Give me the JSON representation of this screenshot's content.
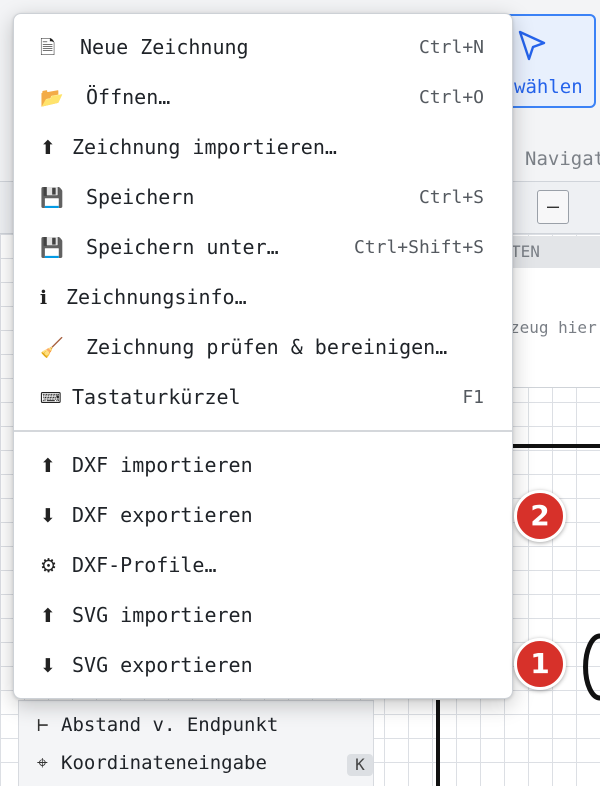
{
  "background": {
    "select_tool_label": "wählen",
    "navigation_tab": "Navigat",
    "collapse_label": "–",
    "props_header": "TEN",
    "props_hint": "zeug hier",
    "snap_items": [
      {
        "glyph": "⊢",
        "label": "Abstand v. Endpunkt"
      },
      {
        "glyph": "⌖",
        "label": "Koordinateneingabe",
        "key": "K"
      }
    ]
  },
  "menu": {
    "items": [
      {
        "icon": "🗎",
        "icon_name": "document-icon",
        "label": "Neue Zeichnung",
        "shortcut": "Ctrl+N"
      },
      {
        "icon": "📂",
        "icon_name": "open-folder-icon",
        "label": "Öffnen…",
        "shortcut": "Ctrl+O"
      },
      {
        "icon": "⬆",
        "icon_name": "upload-icon",
        "label": "Zeichnung importieren…",
        "shortcut": ""
      },
      {
        "icon": "💾",
        "icon_name": "floppy-disk-icon",
        "label": "Speichern",
        "shortcut": "Ctrl+S"
      },
      {
        "icon": "💾",
        "icon_name": "floppy-disk-icon",
        "label": "Speichern unter…",
        "shortcut": "Ctrl+Shift+S"
      },
      {
        "icon": "ℹ",
        "icon_name": "info-icon",
        "label": "Zeichnungsinfo…",
        "shortcut": ""
      },
      {
        "icon": "🧹",
        "icon_name": "broom-icon",
        "label": "Zeichnung prüfen & bereinigen…",
        "shortcut": ""
      },
      {
        "icon": "⌨",
        "icon_name": "keyboard-icon",
        "label": "Tastaturkürzel",
        "shortcut": "F1"
      },
      {
        "icon": "⬆",
        "icon_name": "upload-icon",
        "label": "DXF importieren",
        "shortcut": ""
      },
      {
        "icon": "⬇",
        "icon_name": "download-icon",
        "label": "DXF exportieren",
        "shortcut": ""
      },
      {
        "icon": "⚙",
        "icon_name": "gear-icon",
        "label": "DXF-Profile…",
        "shortcut": ""
      },
      {
        "icon": "⬆",
        "icon_name": "upload-icon",
        "label": "SVG importieren",
        "shortcut": ""
      },
      {
        "icon": "⬇",
        "icon_name": "download-icon",
        "label": "SVG exportieren",
        "shortcut": ""
      }
    ]
  },
  "badges": [
    {
      "number": "2",
      "color": "#d7312a"
    },
    {
      "number": "1",
      "color": "#d7312a"
    }
  ]
}
